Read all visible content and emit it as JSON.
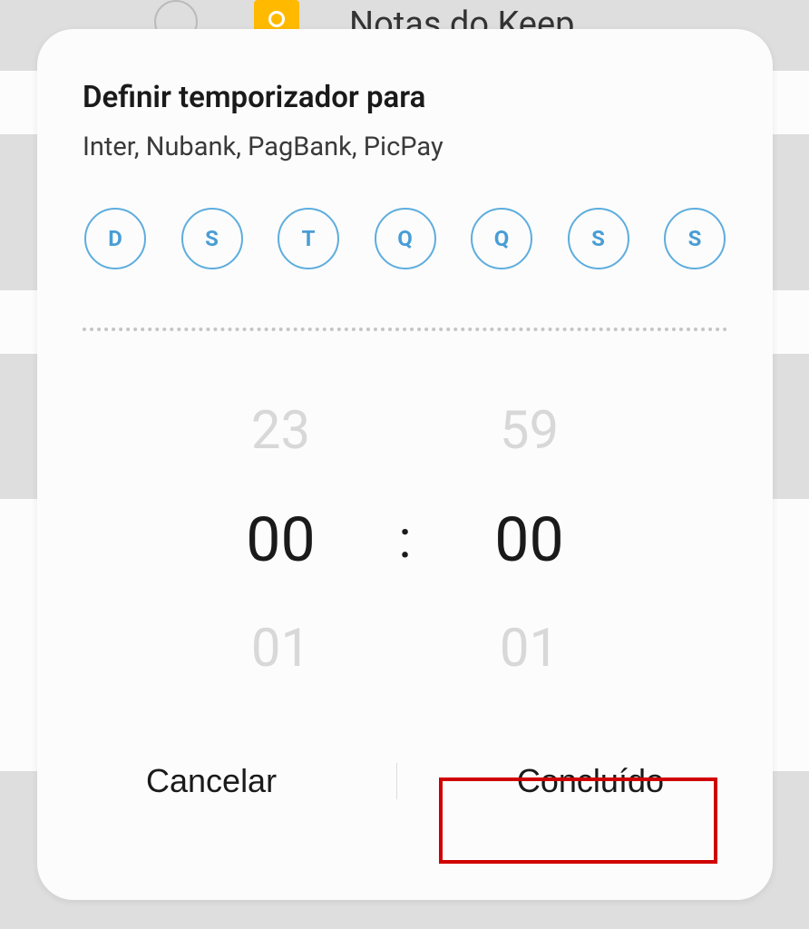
{
  "background": {
    "keep_label": "Notas do Keep"
  },
  "dialog": {
    "title": "Definir temporizador para",
    "subtitle": "Inter, Nubank, PagBank, PicPay",
    "days": [
      "D",
      "S",
      "T",
      "Q",
      "Q",
      "S",
      "S"
    ],
    "time_picker": {
      "hours": {
        "prev": "23",
        "selected": "00",
        "next": "01"
      },
      "separator": ":",
      "minutes": {
        "prev": "59",
        "selected": "00",
        "next": "01"
      }
    },
    "buttons": {
      "cancel": "Cancelar",
      "confirm": "Concluído"
    }
  }
}
